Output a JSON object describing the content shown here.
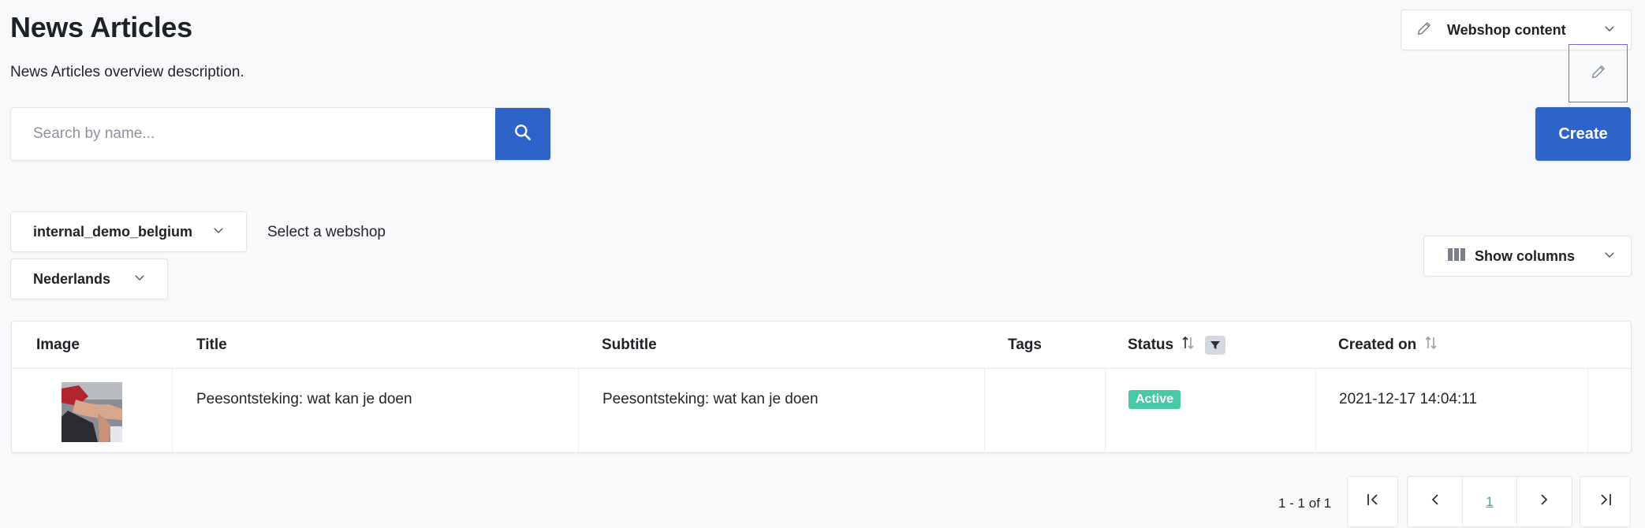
{
  "header": {
    "title": "News Articles",
    "description": "News Articles overview description.",
    "context_select": {
      "label": "Webshop content",
      "icon": "pencil-icon"
    }
  },
  "search": {
    "placeholder": "Search by name...",
    "value": ""
  },
  "create_label": "Create",
  "filters": {
    "webshop": {
      "value": "internal_demo_belgium",
      "hint": "Select a webshop"
    },
    "language": {
      "value": "Nederlands"
    },
    "columns": {
      "label": "Show columns"
    }
  },
  "table": {
    "columns": [
      "Image",
      "Title",
      "Subtitle",
      "Tags",
      "Status",
      "Created on"
    ],
    "rows": [
      {
        "title": "Peesontsteking: wat kan je doen",
        "subtitle": "Peesontsteking: wat kan je doen",
        "tags": "",
        "status": "Active",
        "created_on": "2021-12-17 14:04:11"
      }
    ]
  },
  "pagination": {
    "info": "1 - 1 of 1",
    "current_page": "1"
  },
  "colors": {
    "primary": "#2e64c9",
    "status_active": "#48c9a5",
    "background": "#f8f9fb"
  }
}
